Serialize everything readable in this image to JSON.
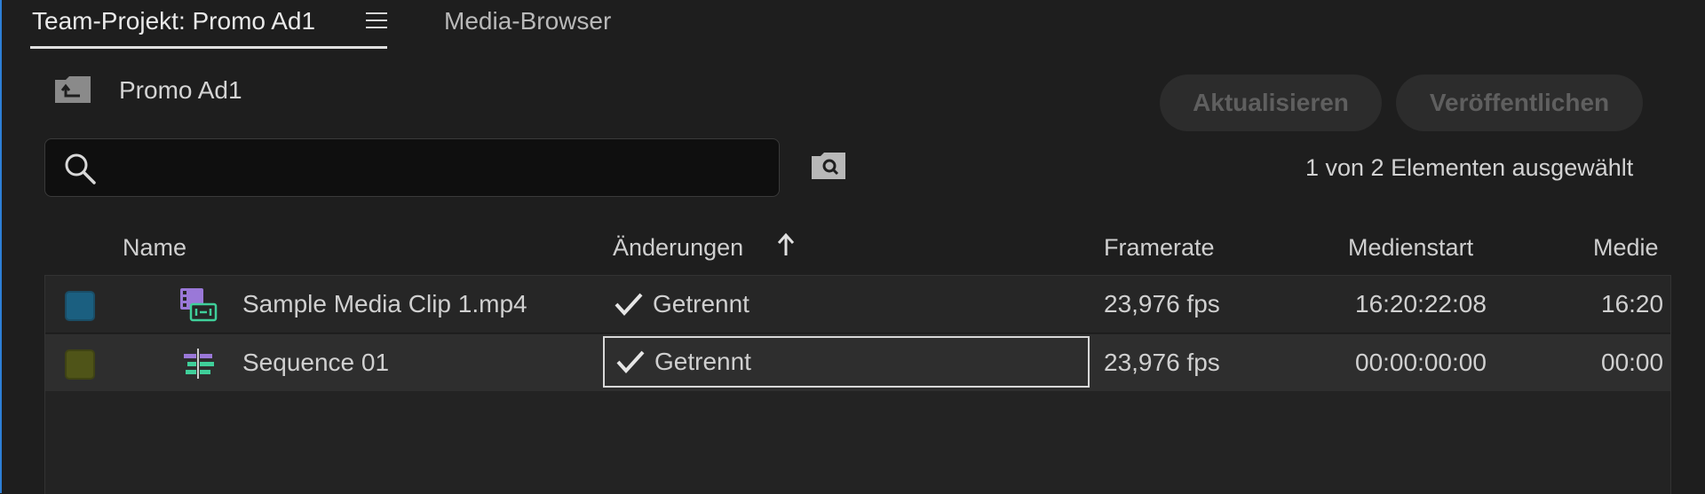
{
  "tabs": {
    "active_label": "Team-Projekt: Promo Ad1",
    "inactive_label": "Media-Browser"
  },
  "breadcrumb": {
    "title": "Promo Ad1"
  },
  "toolbar": {
    "update_label": "Aktualisieren",
    "publish_label": "Veröffentlichen"
  },
  "search": {
    "value": "",
    "placeholder": ""
  },
  "selection_status": "1 von 2 Elementen ausgewählt",
  "columns": {
    "name": "Name",
    "changes": "Änderungen",
    "framerate": "Framerate",
    "media_start": "Medienstart",
    "media_end": "Medie"
  },
  "rows": [
    {
      "name": "Sample Media Clip 1.mp4",
      "changes": "Getrennt",
      "framerate": "23,976 fps",
      "media_start": "16:20:22:08",
      "media_end": "16:20",
      "label_color": "#1b5f80",
      "icon": "video-clip-icon"
    },
    {
      "name": "Sequence 01",
      "changes": "Getrennt",
      "framerate": "23,976 fps",
      "media_start": "00:00:00:00",
      "media_end": "00:00",
      "label_color": "#4f5418",
      "icon": "sequence-icon"
    }
  ],
  "colors": {
    "accent": "#2d7fd6",
    "panel_bg": "#1e1e1e"
  }
}
